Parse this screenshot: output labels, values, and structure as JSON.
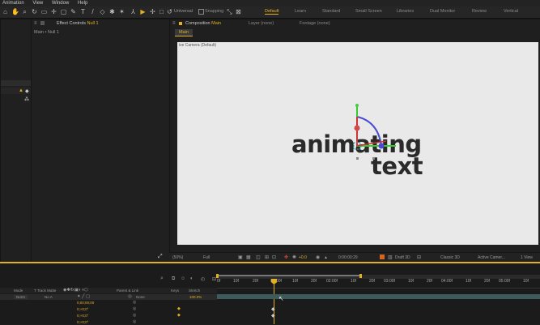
{
  "menu": [
    "Animation",
    "View",
    "Window",
    "Help"
  ],
  "toolbar": {
    "universal_label": "Universal",
    "snapping_label": "Snapping"
  },
  "workspaces": [
    {
      "label": "Default",
      "active": true
    },
    {
      "label": "Learn",
      "active": false
    },
    {
      "label": "Standard",
      "active": false
    },
    {
      "label": "Small Screen",
      "active": false
    },
    {
      "label": "Libraries",
      "active": false
    },
    {
      "label": "Dual Monitor",
      "active": false
    },
    {
      "label": "Review",
      "active": false
    },
    {
      "label": "Vertical",
      "active": false
    }
  ],
  "effect_controls": {
    "tab_label": "Effect Controls",
    "layer_name": "Null 1",
    "breadcrumb": "Main • Null 1"
  },
  "composition": {
    "tab_label": "Composition",
    "comp_name": "Main",
    "layer_tab": "Layer (none)",
    "footage_tab": "Footage (none)",
    "comp_chip": "Main",
    "camera_label": "ive Camera (Default)",
    "text_line1": "animating",
    "text_line2": "text"
  },
  "viewer_bar": {
    "zoom": "(50%)",
    "resolution": "Full",
    "exposure": "+0.0",
    "timecode": "0:00:00:29",
    "draft3d": "Draft 3D",
    "renderer": "Classic 3D",
    "camera": "Active Camer...",
    "views": "1 View"
  },
  "timeline": {
    "ruler": [
      "0f",
      "10f",
      "20f",
      "01:00f",
      "10f",
      "20f",
      "02:00f",
      "10f",
      "20f",
      "03:00f",
      "10f",
      "20f",
      "04:00f",
      "10f",
      "20f",
      "05:00f",
      "10f"
    ],
    "headers": {
      "mode": "Mode",
      "trkmat": "T  Track Matte",
      "parent": "Parent & Link",
      "keys": "Keys",
      "stretch": "Stretch"
    },
    "layer_row": {
      "mode": "Norm",
      "trkmat": "No A",
      "parent": "None",
      "stretch": "100.0%"
    },
    "prop_values": [
      "0;00;00;00",
      "0;+0;0°",
      "0;+0;0°",
      "0;+0;0°",
      "0;+0;0°"
    ]
  },
  "colors": {
    "accent": "#e2b11f",
    "timeline_bar": "#3d5a5d",
    "background": "#1d1d1d"
  }
}
